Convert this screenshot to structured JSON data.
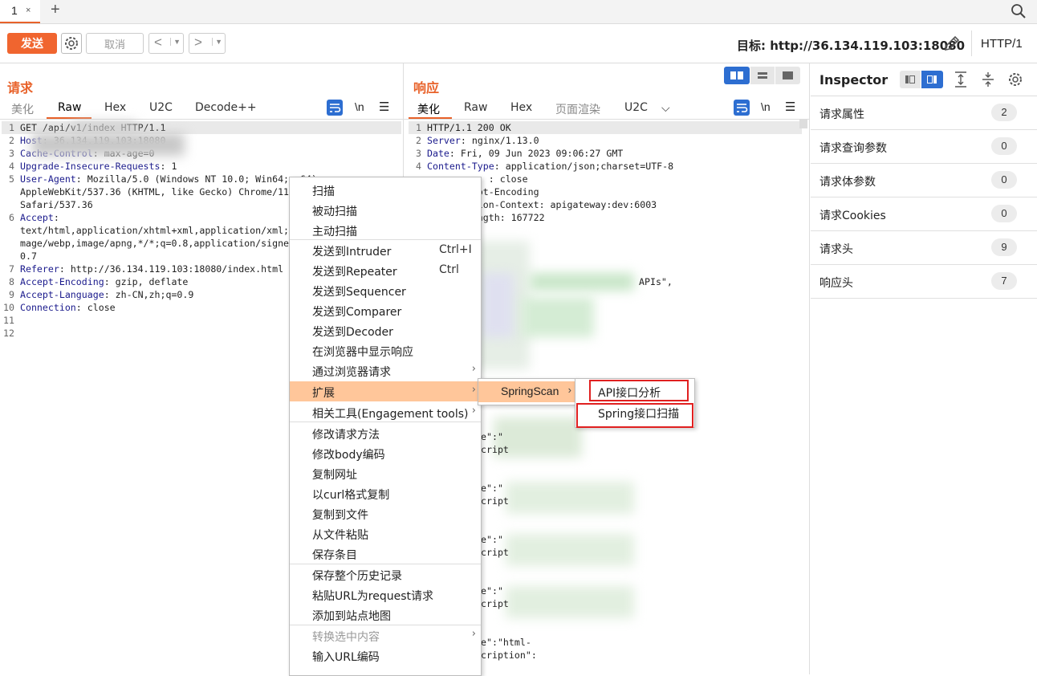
{
  "tabs": {
    "tab_label": "1",
    "close": "×",
    "add": "+"
  },
  "toolbar": {
    "send_label": "发送",
    "cancel_label": "取消",
    "back": "<",
    "forward": ">",
    "target": "目标: http://36.134.119.103:18080",
    "http_version": "HTTP/1"
  },
  "request": {
    "title": "请求",
    "tabs": [
      "美化",
      "Raw",
      "Hex",
      "U2C",
      "Decode++"
    ],
    "active_tab": "Raw",
    "newline_toggle": "\\n",
    "lines": [
      {
        "n": "1",
        "k": "",
        "v": "GET /api/v1/index HTTP/1.1"
      },
      {
        "n": "2",
        "k": "Host",
        "v": ": 36.134.119.103:18080"
      },
      {
        "n": "3",
        "k": "Cache-Control",
        "v": ": max-age=0"
      },
      {
        "n": "4",
        "k": "Upgrade-Insecure-Requests",
        "v": ": 1"
      },
      {
        "n": "5",
        "k": "User-Agent",
        "v": ": Mozilla/5.0 (Windows NT 10.0; Win64; x64)"
      },
      {
        "n": "",
        "k": "",
        "v": "AppleWebKit/537.36 (KHTML, like Gecko) Chrome/114"
      },
      {
        "n": "",
        "k": "",
        "v": "Safari/537.36"
      },
      {
        "n": "6",
        "k": "Accept",
        "v": ":"
      },
      {
        "n": "",
        "k": "",
        "v": "text/html,application/xhtml+xml,application/xml;q"
      },
      {
        "n": "",
        "k": "",
        "v": "mage/webp,image/apng,*/*;q=0.8,application/signed"
      },
      {
        "n": "",
        "k": "",
        "v": "0.7"
      },
      {
        "n": "7",
        "k": "Referer",
        "v": ": http://36.134.119.103:18080/index.html"
      },
      {
        "n": "8",
        "k": "Accept-Encoding",
        "v": ": gzip, deflate"
      },
      {
        "n": "9",
        "k": "Accept-Language",
        "v": ": zh-CN,zh;q=0.9"
      },
      {
        "n": "10",
        "k": "Connection",
        "v": ": close"
      },
      {
        "n": "11",
        "k": "",
        "v": ""
      },
      {
        "n": "12",
        "k": "",
        "v": ""
      }
    ]
  },
  "response": {
    "title": "响应",
    "tabs": [
      "美化",
      "Raw",
      "Hex",
      "页面渲染",
      "U2C"
    ],
    "active_tab": "美化",
    "newline_toggle": "\\n",
    "lines": [
      {
        "n": "1",
        "k": "",
        "v": "HTTP/1.1 200 OK"
      },
      {
        "n": "2",
        "k": "Server",
        "v": ": nginx/1.13.0"
      },
      {
        "n": "3",
        "k": "Date",
        "v": ": Fri, 09 Jun 2023 09:06:27 GMT"
      },
      {
        "n": "4",
        "k": "Content-Type",
        "v": ": application/json;charset=UTF-8"
      },
      {
        "n": "",
        "k": "",
        "v": "           : close"
      },
      {
        "n": "",
        "k": "",
        "v": "         pt-Encoding"
      },
      {
        "n": "",
        "k": "",
        "v": "         ion-Context: apigateway:dev:6003"
      },
      {
        "n": "",
        "k": "",
        "v": "         ngth: 167722"
      }
    ],
    "fragments": [
      "APIs\",",
      "e\":\"",
      "cript",
      "e\":\"",
      "cript",
      "e\":\"",
      "cript",
      "e\":\"",
      "cript",
      "e\":\"html-",
      "cription\":"
    ]
  },
  "inspector": {
    "title": "Inspector",
    "rows": [
      {
        "label": "请求属性",
        "count": "2"
      },
      {
        "label": "请求查询参数",
        "count": "0"
      },
      {
        "label": "请求体参数",
        "count": "0"
      },
      {
        "label": "请求Cookies",
        "count": "0"
      },
      {
        "label": "请求头",
        "count": "9"
      },
      {
        "label": "响应头",
        "count": "7"
      }
    ]
  },
  "context_menu": {
    "items": [
      {
        "label": "扫描"
      },
      {
        "label": "被动扫描"
      },
      {
        "label": "主动扫描"
      },
      {
        "label": "发送到Intruder",
        "shortcut": "Ctrl+I"
      },
      {
        "label": "发送到Repeater",
        "shortcut": "Ctrl"
      },
      {
        "label": "发送到Sequencer"
      },
      {
        "label": "发送到Comparer"
      },
      {
        "label": "发送到Decoder"
      },
      {
        "label": "在浏览器中显示响应"
      },
      {
        "label": "通过浏览器请求"
      },
      {
        "label": "扩展"
      },
      {
        "label": "相关工具(Engagement tools)"
      },
      {
        "label": "修改请求方法"
      },
      {
        "label": "修改body编码"
      },
      {
        "label": "复制网址"
      },
      {
        "label": "以curl格式复制"
      },
      {
        "label": "复制到文件"
      },
      {
        "label": "从文件粘贴"
      },
      {
        "label": "保存条目"
      },
      {
        "label": "保存整个历史记录"
      },
      {
        "label": "粘贴URL为request请求"
      },
      {
        "label": "添加到站点地图"
      },
      {
        "label": "转换选中内容"
      },
      {
        "label": "输入URL编码"
      }
    ],
    "submenu_arrow": "›",
    "extension_submenu": "SpringScan",
    "springscan_items": [
      "API接口分析",
      "Spring接口扫描"
    ]
  }
}
